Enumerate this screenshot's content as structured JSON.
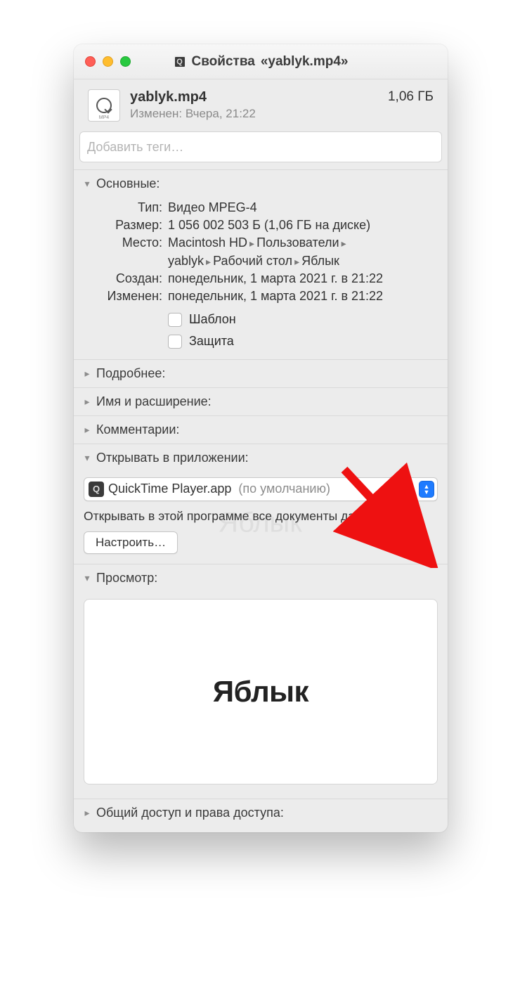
{
  "title_prefix": "Свойства",
  "title_file": "«yablyk.mp4»",
  "header": {
    "filename": "yablyk.mp4",
    "modified_label": "Изменен:",
    "modified_value": "Вчера, 21:22",
    "size": "1,06 ГБ",
    "thumb_ext": "MP4"
  },
  "tags_placeholder": "Добавить теги…",
  "sections": {
    "general": {
      "title": "Основные:",
      "type_label": "Тип:",
      "type_value": "Видео MPEG-4",
      "size_label": "Размер:",
      "size_value": "1 056 002 503 Б (1,06 ГБ на диске)",
      "where_label": "Место:",
      "where_root": "Macintosh HD",
      "where_seg1": "Пользователи",
      "where_seg2": "yablyk",
      "where_seg3": "Рабочий стол",
      "where_seg4": "Яблык",
      "created_label": "Создан:",
      "created_value": "понедельник, 1 марта 2021 г. в 21:22",
      "modified_label": "Изменен:",
      "modified_value": "понедельник, 1 марта 2021 г. в 21:22",
      "template_label": "Шаблон",
      "lock_label": "Защита"
    },
    "more": "Подробнее:",
    "name_ext": "Имя и расширение:",
    "comments": "Комментарии:",
    "open_with": {
      "title": "Открывать в приложении:",
      "app": "QuickTime Player.app",
      "default_suffix": "(по умолчанию)",
      "help": "Открывать в этой программе все документы данного типа.",
      "change_btn": "Настроить…"
    },
    "preview": {
      "title": "Просмотр:",
      "content": "Яблык"
    },
    "sharing": "Общий доступ и права доступа:"
  },
  "watermark": "Яблык"
}
